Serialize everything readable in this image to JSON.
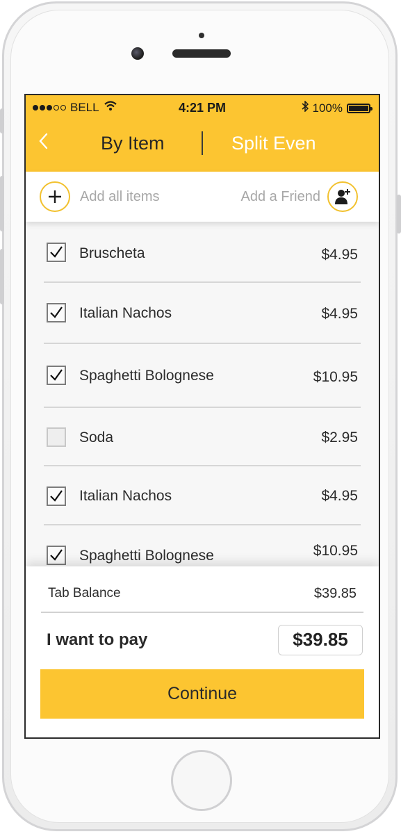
{
  "status_bar": {
    "carrier": "BELL",
    "time": "4:21 PM",
    "battery_percent": "100%",
    "signal_bars_filled": 3,
    "signal_bars_total": 5,
    "icons": [
      "signal-dots-icon",
      "wifi-icon",
      "bluetooth-icon",
      "battery-icon"
    ]
  },
  "nav": {
    "back_icon": "chevron-left-icon",
    "tabs": [
      {
        "label": "By Item",
        "active": true
      },
      {
        "label": "Split Even",
        "active": false
      }
    ]
  },
  "actions": {
    "add_items_icon": "plus-icon",
    "add_items_label": "Add all items",
    "add_friend_label": "Add a Friend",
    "add_friend_icon": "add-person-icon"
  },
  "items": [
    {
      "name": "Bruscheta",
      "price": "$4.95",
      "checked": true
    },
    {
      "name": "Italian Nachos",
      "price": "$4.95",
      "checked": true
    },
    {
      "name": "Spaghetti Bolognese",
      "price": "$10.95",
      "checked": true
    },
    {
      "name": "Soda",
      "price": "$2.95",
      "checked": false
    },
    {
      "name": "Italian Nachos",
      "price": "$4.95",
      "checked": true
    },
    {
      "name": "Spaghetti Bolognese",
      "price": "$10.95",
      "checked": true
    }
  ],
  "summary": {
    "tab_balance_label": "Tab Balance",
    "tab_balance_value": "$39.85",
    "pay_label": "I want to pay",
    "pay_value": "$39.85",
    "continue_label": "Continue"
  },
  "colors": {
    "accent": "#fcc531",
    "accent_border": "#f2c12e",
    "text_dark": "#2b2b2b",
    "text_muted": "#a7a7a7"
  }
}
